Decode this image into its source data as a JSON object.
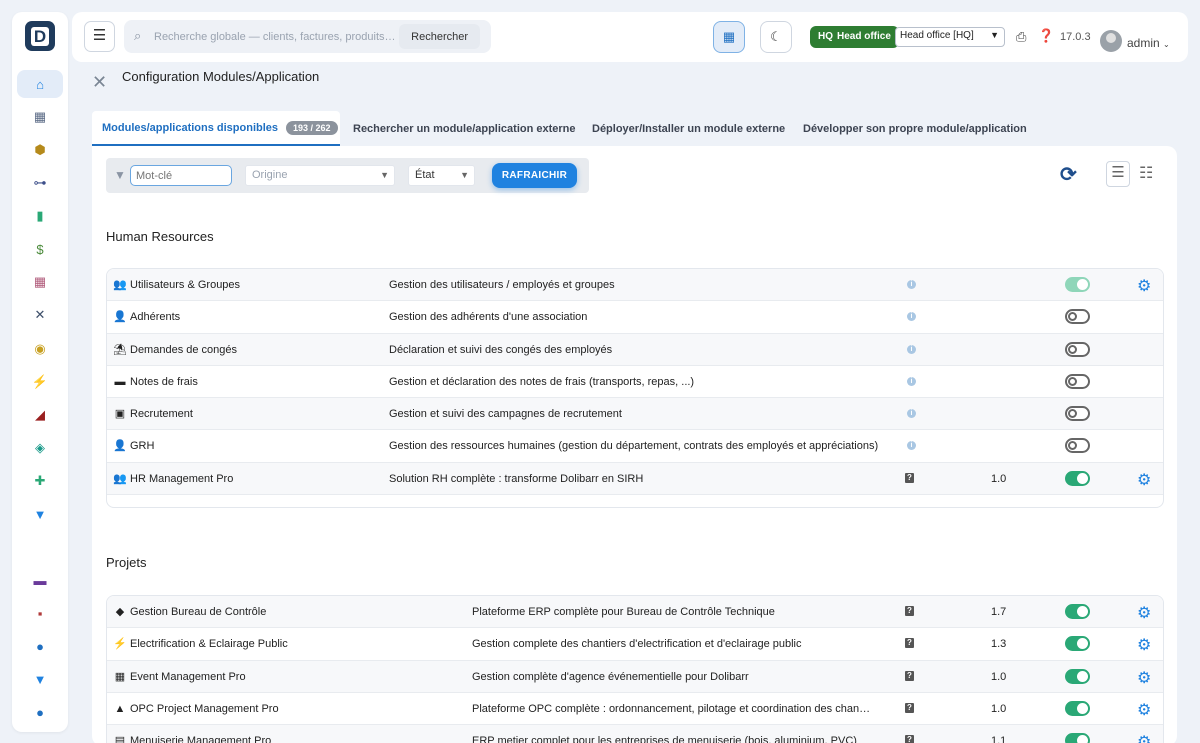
{
  "header": {
    "search_placeholder": "Recherche globale — clients, factures, produits…",
    "search_button": "Rechercher",
    "hq_prefix": "HQ",
    "hq_label": "Head office",
    "entity_value": "Head office [HQ]",
    "version": "17.0.3",
    "user": "admin"
  },
  "page": {
    "title": "Configuration Modules/Application"
  },
  "tabs": [
    {
      "label": "Modules/applications disponibles",
      "badge": "193 / 262"
    },
    {
      "label": "Rechercher un module/application externe"
    },
    {
      "label": "Déployer/Installer un module externe"
    },
    {
      "label": "Développer son propre module/application"
    }
  ],
  "filters": {
    "keyword_placeholder": "Mot-clé",
    "origin_placeholder": "Origine",
    "state_label": "État",
    "refresh_button": "RAFRAICHIR"
  },
  "sections": [
    {
      "title": "Human Resources",
      "modules": [
        {
          "icon": "users-icon",
          "glyph": "👥",
          "name": "Utilisateurs & Groupes",
          "desc": "Gestion des utilisateurs / employés et groupes",
          "ver": "",
          "state": "soft",
          "config": true
        },
        {
          "icon": "member-icon",
          "glyph": "👤",
          "name": "Adhérents",
          "desc": "Gestion des adhérents d'une association",
          "ver": "",
          "state": "off",
          "config": false
        },
        {
          "icon": "holiday-icon",
          "glyph": "⛱",
          "name": "Demandes de congés",
          "desc": "Déclaration et suivi des congés des employés",
          "ver": "",
          "state": "off",
          "config": false
        },
        {
          "icon": "expense-icon",
          "glyph": "▬",
          "name": "Notes de frais",
          "desc": "Gestion et déclaration des notes de frais (transports, repas, ...)",
          "ver": "",
          "state": "off",
          "config": false
        },
        {
          "icon": "recruitment-icon",
          "glyph": "▣",
          "name": "Recrutement",
          "desc": "Gestion et suivi des campagnes de recrutement",
          "ver": "",
          "state": "off",
          "config": false
        },
        {
          "icon": "hrm-icon",
          "glyph": "👤",
          "name": "GRH",
          "desc": "Gestion des ressources humaines (gestion du département, contrats des employés et appréciations)",
          "ver": "",
          "state": "off",
          "config": false
        },
        {
          "icon": "hr-pro-icon",
          "glyph": "👥",
          "name": "HR Management Pro",
          "desc": "Solution RH complète : transforme Dolibarr en SIRH",
          "ver": "1.0",
          "state": "on",
          "config": true,
          "external": true
        }
      ]
    },
    {
      "title": "Projets",
      "modules": [
        {
          "icon": "control-office-icon",
          "glyph": "◆",
          "name": "Gestion Bureau de Contrôle",
          "desc": "Plateforme ERP complète pour Bureau de Contrôle Technique",
          "ver": "1.7",
          "state": "on",
          "config": true,
          "external": true
        },
        {
          "icon": "lightning-icon",
          "glyph": "⚡",
          "name": "Electrification & Eclairage Public",
          "desc": "Gestion complete des chantiers d'electrification et d'eclairage public",
          "ver": "1.3",
          "state": "on",
          "config": true,
          "external": true
        },
        {
          "icon": "event-icon",
          "glyph": "▦",
          "name": "Event Management Pro",
          "desc": "Gestion complète d'agence événementielle pour Dolibarr",
          "ver": "1.0",
          "state": "on",
          "config": true,
          "external": true
        },
        {
          "icon": "opc-icon",
          "glyph": "▲",
          "name": "OPC Project Management Pro",
          "desc": "Plateforme OPC complète : ordonnancement, pilotage et coordination des chantier…",
          "ver": "1.0",
          "state": "on",
          "config": true,
          "external": true
        },
        {
          "icon": "carpentry-icon",
          "glyph": "▤",
          "name": "Menuiserie Management Pro",
          "desc": "ERP metier complet pour les entreprises de menuiserie (bois, aluminium, PVC)",
          "ver": "1.1",
          "state": "on",
          "config": true,
          "external": true
        }
      ]
    }
  ],
  "sidebar": [
    {
      "name": "home-icon",
      "glyph": "⌂",
      "color": "#1f82e0"
    },
    {
      "name": "company-icon",
      "glyph": "▦",
      "color": "#5a6a85"
    },
    {
      "name": "product-icon",
      "glyph": "⬢",
      "color": "#b58a1b"
    },
    {
      "name": "tree-icon",
      "glyph": "⊶",
      "color": "#3d4f8a"
    },
    {
      "name": "briefcase-icon",
      "glyph": "▮",
      "color": "#2aa876"
    },
    {
      "name": "invoice-icon",
      "glyph": "$",
      "color": "#4a8a3a"
    },
    {
      "name": "calendar-icon",
      "glyph": "▦",
      "color": "#b05a7a"
    },
    {
      "name": "tools-icon",
      "glyph": "✕",
      "color": "#3d4f6a"
    },
    {
      "name": "eye-icon",
      "glyph": "◉",
      "color": "#c8a021"
    },
    {
      "name": "bolt-icon",
      "glyph": "⚡",
      "color": "#e6b800"
    },
    {
      "name": "pin-icon",
      "glyph": "◢",
      "color": "#9a2020"
    },
    {
      "name": "shield-icon",
      "glyph": "◈",
      "color": "#1a9a8a"
    },
    {
      "name": "plus-icon",
      "glyph": "✚",
      "color": "#2aa876"
    },
    {
      "name": "filter-icon",
      "glyph": "▼",
      "color": "#1f82e0"
    },
    {
      "name": "calendar2-icon",
      "glyph": "▬",
      "color": "#6a3a9a"
    },
    {
      "name": "gift-icon",
      "glyph": "▪",
      "color": "#b03a3a"
    },
    {
      "name": "flask-icon",
      "glyph": "●",
      "color": "#1f6fc1"
    },
    {
      "name": "funnel-icon",
      "glyph": "▼",
      "color": "#1f82e0"
    },
    {
      "name": "cloud-icon",
      "glyph": "●",
      "color": "#1f6fc1"
    }
  ]
}
